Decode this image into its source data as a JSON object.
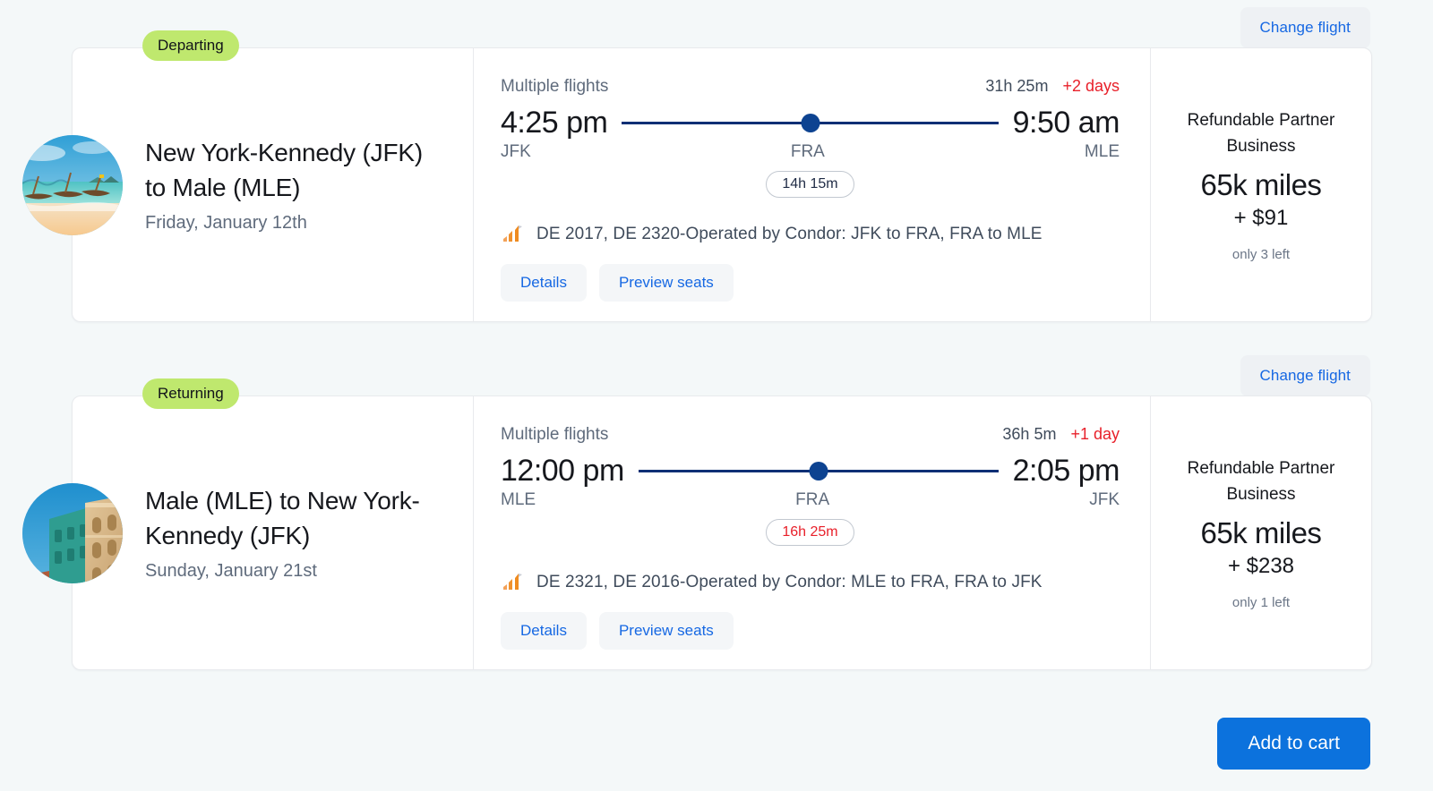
{
  "colors": {
    "background": "#f4f8f9",
    "card": "#ffffff",
    "badge_green": "#bfe86e",
    "link_blue": "#1668e3",
    "primary_blue": "#0c72dd",
    "timeline_navy": "#0d2f75",
    "alert_red": "#e8202a",
    "muted_text": "#5f6b7c",
    "airline_orange": "#f0922f"
  },
  "segments": [
    {
      "badge": "Departing",
      "change_flight_label": "Change flight",
      "thumbnail_name": "beach-longtail-boats-thumbnail",
      "route_title": "New York-Kennedy (JFK) to Male (MLE)",
      "route_date": "Friday, January 12th",
      "flights_label": "Multiple flights",
      "duration": "31h 25m",
      "plus_days": "+2 days",
      "depart_time": "4:25 pm",
      "depart_code": "JFK",
      "stop_code": "FRA",
      "arrive_time": "9:50 am",
      "arrive_code": "MLE",
      "layover": "14h 15m",
      "layover_warning": false,
      "flight_numbers": "DE 2017, DE 2320-Operated by Condor: JFK to FRA, FRA to MLE",
      "details_label": "Details",
      "preview_seats_label": "Preview seats",
      "fare_line1": "Refundable Partner",
      "fare_line2": "Business",
      "miles": "65k miles",
      "cash": "+ $91",
      "seats_left": "only 3 left"
    },
    {
      "badge": "Returning",
      "change_flight_label": "Change flight",
      "thumbnail_name": "city-building-facade-thumbnail",
      "route_title": "Male (MLE) to New York-Kennedy (JFK)",
      "route_date": "Sunday, January 21st",
      "flights_label": "Multiple flights",
      "duration": "36h 5m",
      "plus_days": "+1 day",
      "depart_time": "12:00 pm",
      "depart_code": "MLE",
      "stop_code": "FRA",
      "arrive_time": "2:05 pm",
      "arrive_code": "JFK",
      "layover": "16h 25m",
      "layover_warning": true,
      "flight_numbers": "DE 2321, DE 2016-Operated by Condor: MLE to FRA, FRA to JFK",
      "details_label": "Details",
      "preview_seats_label": "Preview seats",
      "fare_line1": "Refundable Partner",
      "fare_line2": "Business",
      "miles": "65k miles",
      "cash": "+ $238",
      "seats_left": "only 1 left"
    }
  ],
  "footer": {
    "add_to_cart_label": "Add to cart"
  }
}
